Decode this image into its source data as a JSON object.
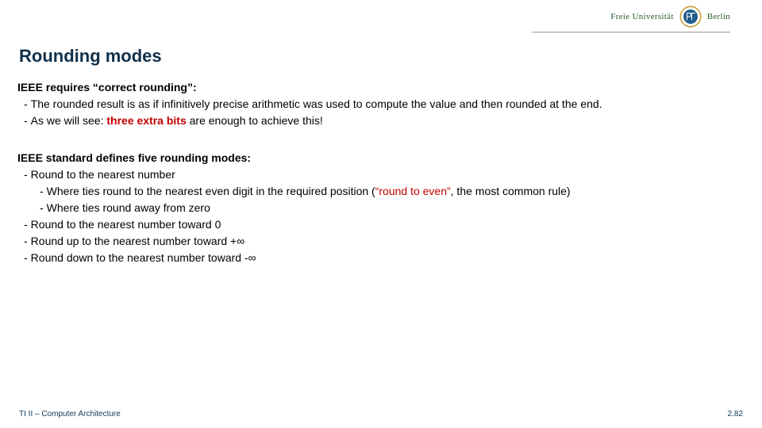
{
  "logo": {
    "text_left": "Freie Universität",
    "text_right": "Berlin",
    "seal_color": "#1e5a8a",
    "seal_ring": "#c59a2a"
  },
  "title": "Rounding modes",
  "section1": {
    "lead": "IEEE requires “correct rounding”:",
    "b1": "The rounded result is as if infinitively precise arithmetic was used to compute the value and then rounded at the end.",
    "b2_pre": "As we will see: ",
    "b2_red": "three extra bits",
    "b2_post": " are enough to achieve this!"
  },
  "section2": {
    "lead": "IEEE standard defines five rounding modes:",
    "r1": "Round to the nearest number",
    "r1a_pre": "Where ties round to the nearest even digit in the required position (",
    "r1a_red": "“round to even”",
    "r1a_post": ", the most common rule)",
    "r1b": "Where ties round away from zero",
    "r2": "Round to the nearest number toward 0",
    "r3": "Round up to the nearest number toward +∞",
    "r4": "Round down to the nearest number toward -∞"
  },
  "footer": {
    "left": "TI II – Computer Architecture",
    "right": "2.82"
  }
}
